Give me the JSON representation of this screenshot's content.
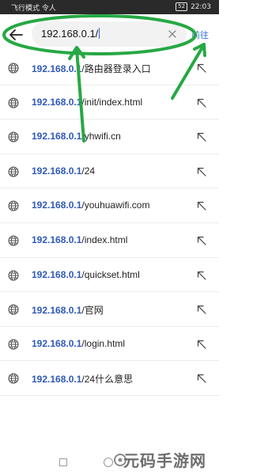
{
  "status_bar": {
    "left_text": "飞行模式 令人",
    "battery": "52",
    "time": "22:03"
  },
  "search": {
    "value": "192.168.0.1/",
    "go_label": "前往"
  },
  "suggestions": [
    {
      "prefix": "192.168.0.1",
      "suffix": "/路由器登录入口"
    },
    {
      "prefix": "192.168.0.1",
      "suffix": "/init/index.html"
    },
    {
      "prefix": "192.168.0.1",
      "suffix": "/yhwifi.cn"
    },
    {
      "prefix": "192.168.0.1",
      "suffix": "/24"
    },
    {
      "prefix": "192.168.0.1",
      "suffix": "/youhuawifi.com"
    },
    {
      "prefix": "192.168.0.1",
      "suffix": "/index.html"
    },
    {
      "prefix": "192.168.0.1",
      "suffix": "/quickset.html"
    },
    {
      "prefix": "192.168.0.1",
      "suffix": "/官网"
    },
    {
      "prefix": "192.168.0.1",
      "suffix": "/login.html"
    },
    {
      "prefix": "192.168.0.1",
      "suffix": "/24什么意思"
    }
  ],
  "watermark": "元码手游网",
  "colors": {
    "annotation": "#27a844",
    "link_prefix": "#2f58b8",
    "go": "#2f6fd0"
  },
  "icons": {
    "back": "back-arrow-icon",
    "clear": "clear-icon",
    "globe": "globe-icon",
    "fill": "fill-suggestion-arrow-icon"
  }
}
